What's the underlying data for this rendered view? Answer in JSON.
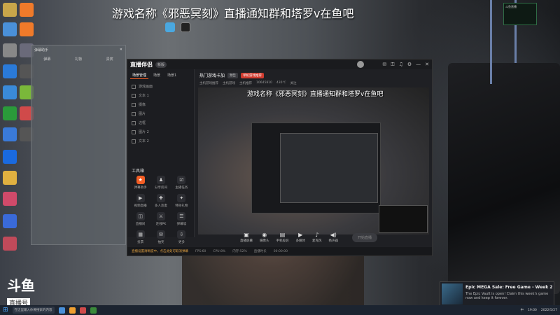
{
  "overlay": {
    "title": "游戏名称《邪恶冥刻》直播通知群和塔罗v在鱼吧"
  },
  "branding": {
    "logo": "斗鱼",
    "sub": "直播号",
    "room_id": "10645810"
  },
  "left_panel": {
    "header": "弹幕助手",
    "tabs": [
      "弹幕",
      "礼物",
      "贵宾"
    ]
  },
  "app": {
    "logo": "直播伴侣",
    "version_badge": "新版",
    "sidebar_tabs": [
      "场景管理",
      "场景",
      "场景1"
    ],
    "scene_items": [
      "游戏画面",
      "文本 1",
      "摄像",
      "图片",
      "边框",
      "图片 2",
      "文本 2",
      "图片 3"
    ],
    "tools_header": "工具箱",
    "tools": [
      {
        "label": "弹幕助手",
        "glyph": "★",
        "hot": true
      },
      {
        "label": "分享房间",
        "glyph": "♟",
        "hot": false
      },
      {
        "label": "主播任务",
        "glyph": "☑",
        "hot": false
      },
      {
        "label": "视频直播",
        "glyph": "▶",
        "hot": false
      },
      {
        "label": "多人连麦",
        "glyph": "✚",
        "hot": false
      },
      {
        "label": "特效礼物",
        "glyph": "✦",
        "hot": false
      },
      {
        "label": "直播间",
        "glyph": "◫",
        "hot": false
      },
      {
        "label": "连线PK",
        "glyph": "⚔",
        "hot": false
      },
      {
        "label": "弹幕墙",
        "glyph": "☰",
        "hot": false
      },
      {
        "label": "投票",
        "glyph": "▦",
        "hot": false
      },
      {
        "label": "抽奖",
        "glyph": "✉",
        "hot": false
      },
      {
        "label": "更多",
        "glyph": "⇩",
        "hot": false
      }
    ],
    "stream_name": "热门游戏卡加",
    "tag_grey": "预告",
    "tag_red": "单机游戏推荐",
    "meta": [
      "主机游戏推荐",
      "主机游戏",
      "主机推荐",
      "10645810",
      "430℃",
      "关注"
    ],
    "preview_caption": "游戏名称《邪恶冥刻》直播通知群和塔罗v在鱼吧",
    "actions": [
      {
        "label": "直播屏幕",
        "glyph": "▣"
      },
      {
        "label": "摄像头",
        "glyph": "◉"
      },
      {
        "label": "手机投屏",
        "glyph": "▤"
      },
      {
        "label": "多媒体",
        "glyph": "▶"
      },
      {
        "label": "麦克风",
        "glyph": "♪"
      },
      {
        "label": "扬声器",
        "glyph": "◀)"
      }
    ],
    "start_button": "开始直播",
    "status": [
      "直播设置清晰度中，点击此处可取消弹幕",
      "FPS:60",
      "CPU:8%",
      "内存:52%",
      "直播时长",
      "00:00:00"
    ]
  },
  "notification": {
    "chip_title": "斗鱼直播",
    "toast_title": "Epic MEGA Sale: Free Game - Week 2",
    "toast_body": "The Epic Vault is open! Claim this week's game now and keep it forever."
  },
  "taskbar": {
    "search_text": "在这里输入你要搜索的内容",
    "time": "19:00",
    "date": "2022/5/27",
    "lang": "中"
  }
}
